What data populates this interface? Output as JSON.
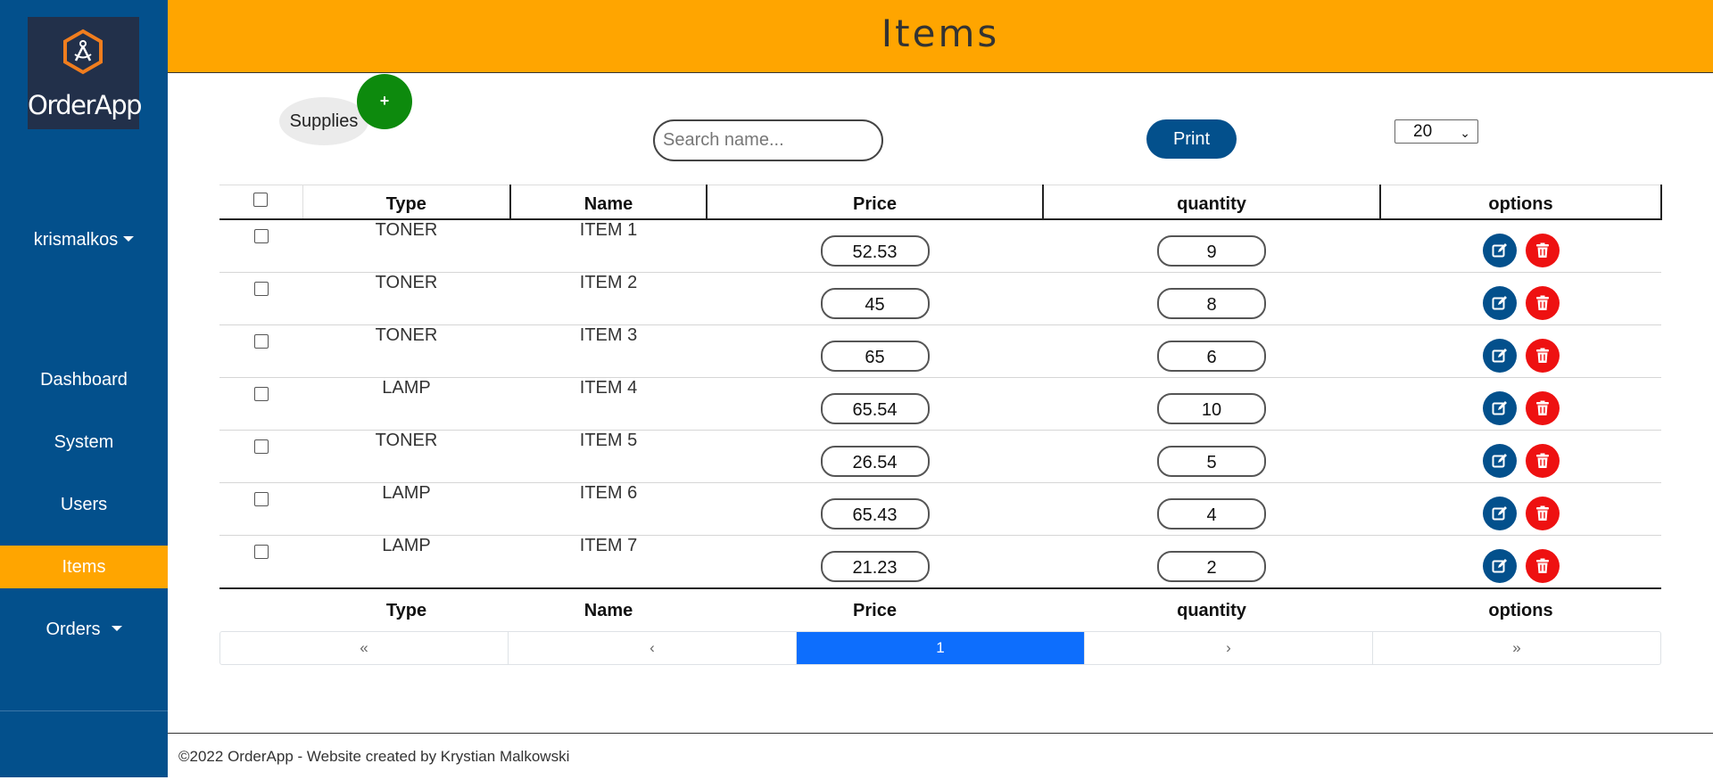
{
  "brand": {
    "name": "OrderApp"
  },
  "sidebar": {
    "user": "krismalkos",
    "items": [
      {
        "label": "Dashboard",
        "active": false
      },
      {
        "label": "System",
        "active": false
      },
      {
        "label": "Users",
        "active": false
      },
      {
        "label": "Items",
        "active": true
      },
      {
        "label": "Orders",
        "active": false,
        "has_dropdown": true
      }
    ]
  },
  "header": {
    "title": "Items"
  },
  "toolbar": {
    "supplies_label": "Supplies",
    "add_label": "+",
    "search_placeholder": "Search name...",
    "search_value": "",
    "print_label": "Print",
    "page_size": "20"
  },
  "table": {
    "columns": [
      "Type",
      "Name",
      "Price",
      "quantity",
      "options"
    ],
    "rows": [
      {
        "type": "TONER",
        "name": "ITEM 1",
        "price": "52.53",
        "quantity": "9"
      },
      {
        "type": "TONER",
        "name": "ITEM 2",
        "price": "45",
        "quantity": "8"
      },
      {
        "type": "TONER",
        "name": "ITEM 3",
        "price": "65",
        "quantity": "6"
      },
      {
        "type": "LAMP",
        "name": "ITEM 4",
        "price": "65.54",
        "quantity": "10"
      },
      {
        "type": "TONER",
        "name": "ITEM 5",
        "price": "26.54",
        "quantity": "5"
      },
      {
        "type": "LAMP",
        "name": "ITEM 6",
        "price": "65.43",
        "quantity": "4"
      },
      {
        "type": "LAMP",
        "name": "ITEM 7",
        "price": "21.23",
        "quantity": "2"
      }
    ]
  },
  "pagination": {
    "first": "«",
    "prev": "‹",
    "current": "1",
    "next": "›",
    "last": "»"
  },
  "footer": {
    "text": "©2022 OrderApp - Website created by Krystian Malkowski"
  },
  "colors": {
    "sidebar": "#03508c",
    "accent": "#ffa500",
    "add": "#0d8a0d",
    "delete": "#ee1111",
    "page_active": "#0d6efd"
  },
  "icons": {
    "logo": "compass-hexagon-icon",
    "edit": "edit-icon",
    "delete": "trash-icon"
  }
}
